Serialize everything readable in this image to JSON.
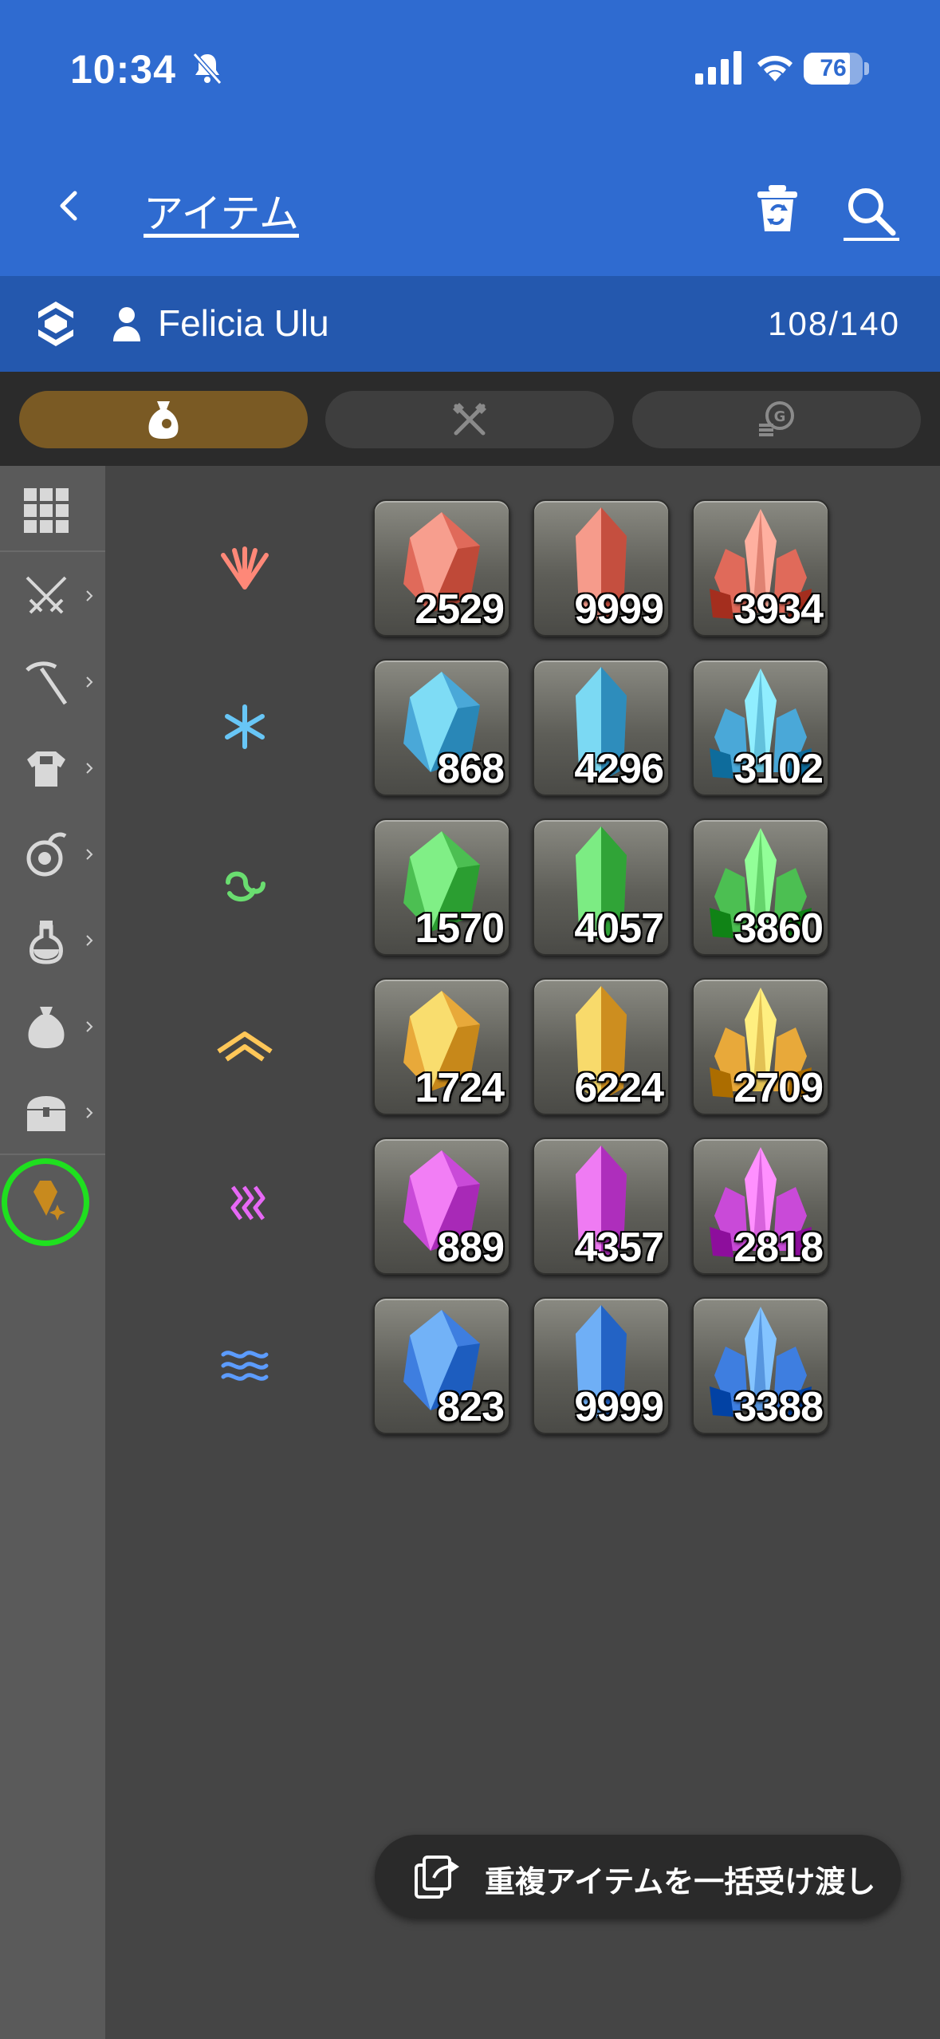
{
  "status_bar": {
    "time": "10:34",
    "battery": "76"
  },
  "header": {
    "title": "アイテム"
  },
  "character": {
    "name": "Felicia Ulu",
    "capacity": "108/140"
  },
  "filter_tabs": [
    {
      "icon": "bag-icon",
      "active": true
    },
    {
      "icon": "crossed-tools-icon",
      "active": false
    },
    {
      "icon": "coins-icon",
      "active": false
    }
  ],
  "sidebar": {
    "items": [
      {
        "icon": "grid-icon",
        "has_chevron": false
      },
      {
        "icon": "crossed-swords-icon",
        "has_chevron": true
      },
      {
        "icon": "pickaxe-icon",
        "has_chevron": true
      },
      {
        "icon": "armor-icon",
        "has_chevron": true
      },
      {
        "icon": "food-icon",
        "has_chevron": true
      },
      {
        "icon": "potion-icon",
        "has_chevron": true
      },
      {
        "icon": "sack-icon",
        "has_chevron": true
      },
      {
        "icon": "chest-icon",
        "has_chevron": true
      },
      {
        "icon": "crystal-icon",
        "has_chevron": false,
        "selected": true
      }
    ]
  },
  "crystal_rows": [
    {
      "element": "fire-icon",
      "color": "#e06a5a",
      "counts": [
        "2529",
        "9999",
        "3934"
      ]
    },
    {
      "element": "ice-icon",
      "color": "#4aa8d8",
      "counts": [
        "868",
        "4296",
        "3102"
      ]
    },
    {
      "element": "wind-icon",
      "color": "#4cbf52",
      "counts": [
        "1570",
        "4057",
        "3860"
      ]
    },
    {
      "element": "earth-icon",
      "color": "#e8a93a",
      "counts": [
        "1724",
        "6224",
        "2709"
      ]
    },
    {
      "element": "lightning-icon",
      "color": "#c94ad8",
      "counts": [
        "889",
        "4357",
        "2818"
      ]
    },
    {
      "element": "water-icon",
      "color": "#3e7ee0",
      "counts": [
        "823",
        "9999",
        "3388"
      ]
    }
  ],
  "bulk_action": {
    "label": "重複アイテムを一括受け渡し"
  }
}
